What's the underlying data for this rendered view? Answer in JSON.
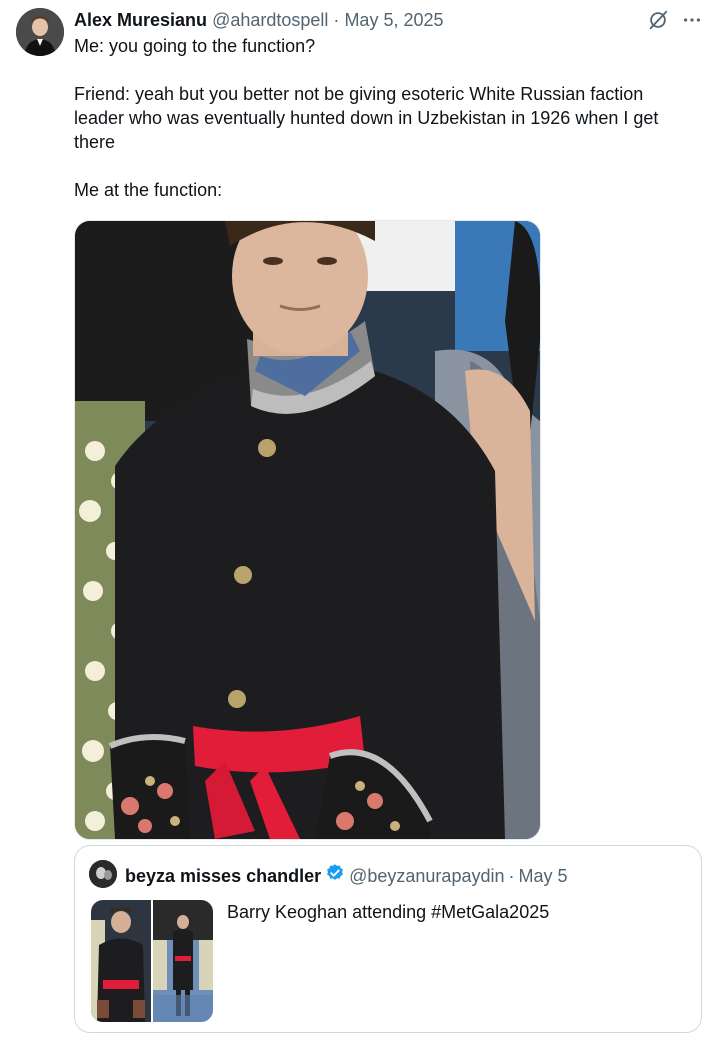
{
  "author": {
    "name": "Alex Muresianu",
    "handle": "@ahardtospell",
    "separator": "·",
    "date": "May 5, 2025"
  },
  "icons": {
    "grok": "grok-icon",
    "more": "more-icon",
    "verified": "verified-badge-icon"
  },
  "tweet": {
    "text": "Me: you going to the function?\n\nFriend: yeah but you better not be giving esoteric White Russian faction leader who was eventually hunted down in Uzbekistan in 1926 when I get there\n\nMe at the function:"
  },
  "quote": {
    "name": "beyza misses chandler",
    "handle": "@beyzanurapaydin",
    "separator": "·",
    "date": "May 5",
    "text": "Barry Keoghan attending #MetGala2025"
  },
  "colors": {
    "text": "#0f1419",
    "secondary": "#536471",
    "verified": "#1d9bf0",
    "border": "#cfd9de"
  }
}
